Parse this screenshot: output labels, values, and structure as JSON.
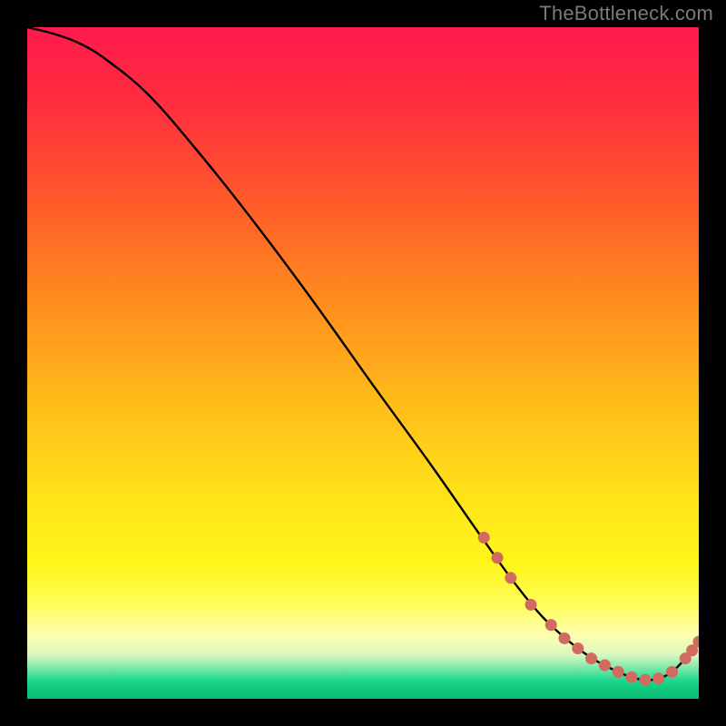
{
  "attribution": "TheBottleneck.com",
  "colors": {
    "background": "#000000",
    "gradient_stops": [
      {
        "offset": 0.0,
        "color": "#ff1a4d"
      },
      {
        "offset": 0.12,
        "color": "#ff2f3e"
      },
      {
        "offset": 0.26,
        "color": "#ff5a2a"
      },
      {
        "offset": 0.4,
        "color": "#ff8a1f"
      },
      {
        "offset": 0.55,
        "color": "#ffb91a"
      },
      {
        "offset": 0.7,
        "color": "#ffe31a"
      },
      {
        "offset": 0.8,
        "color": "#fff61a"
      },
      {
        "offset": 0.86,
        "color": "#fffd5a"
      },
      {
        "offset": 0.905,
        "color": "#fffeb0"
      },
      {
        "offset": 0.935,
        "color": "#d8f7c0"
      },
      {
        "offset": 0.955,
        "color": "#77e8a8"
      },
      {
        "offset": 0.972,
        "color": "#1fd98f"
      },
      {
        "offset": 0.985,
        "color": "#0fc97c"
      },
      {
        "offset": 1.0,
        "color": "#0bbd74"
      }
    ],
    "curve": "#000000",
    "marker": "#d16a5f",
    "attribution_text": "#7a7a7a"
  },
  "chart_data": {
    "type": "line",
    "title": "",
    "xlabel": "",
    "ylabel": "",
    "xlim": [
      0,
      100
    ],
    "ylim": [
      0,
      100
    ],
    "grid": false,
    "series": [
      {
        "name": "bottleneck-curve",
        "x": [
          0,
          4,
          8,
          12,
          18,
          25,
          33,
          42,
          52,
          60,
          67,
          72,
          76,
          79,
          82,
          85,
          88,
          90,
          92,
          94,
          96,
          98,
          100
        ],
        "values": [
          100,
          99,
          97.5,
          95,
          90,
          82,
          72,
          60,
          46,
          35,
          25,
          18,
          13,
          10,
          7.5,
          5.5,
          4,
          3.2,
          2.8,
          3,
          4,
          6,
          8.5
        ]
      }
    ],
    "markers": {
      "name": "highlighted-points",
      "x": [
        68,
        70,
        72,
        75,
        78,
        80,
        82,
        84,
        86,
        88,
        90,
        92,
        94,
        96,
        98,
        99,
        100
      ],
      "values": [
        24,
        21,
        18,
        14,
        11,
        9,
        7.5,
        6,
        5,
        4,
        3.2,
        2.8,
        3,
        4,
        6,
        7.2,
        8.5
      ]
    }
  }
}
